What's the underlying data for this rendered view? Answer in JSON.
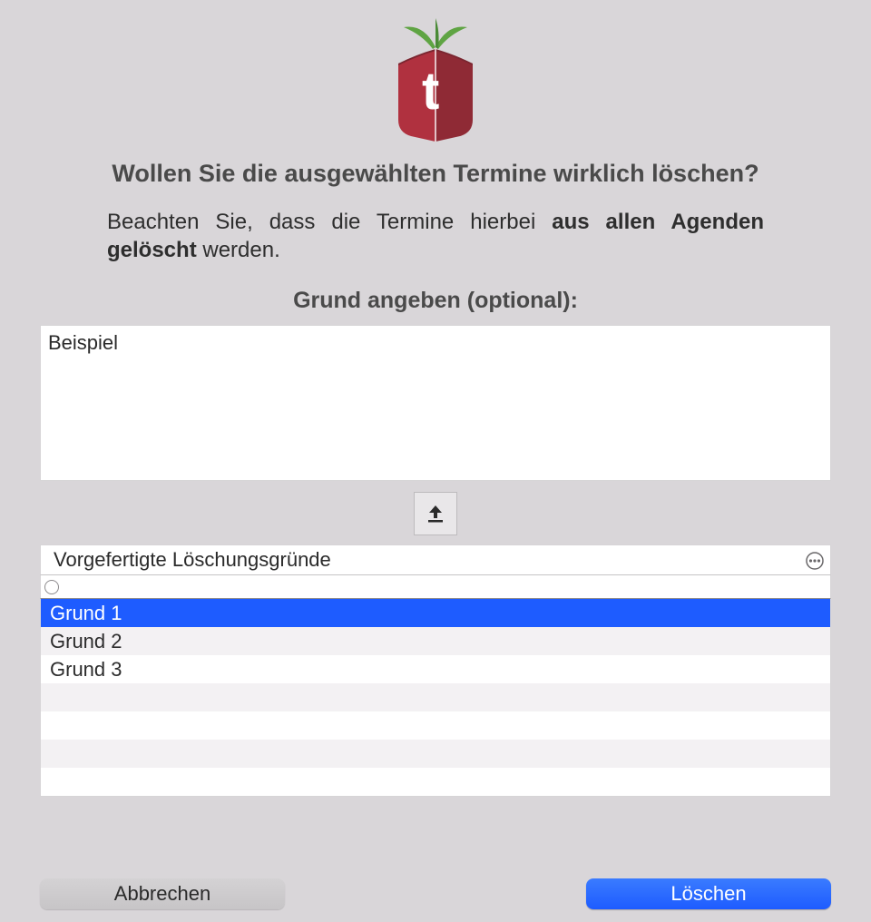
{
  "dialog": {
    "title": "Wollen Sie die ausgewählten Termine wirklich löschen?",
    "body_pre": "Beachten Sie, dass die Termine hierbei ",
    "body_bold": "aus allen Agenden gelöscht",
    "body_post": " werden.",
    "reason_label": "Grund angeben (optional):",
    "reason_value": "Beispiel",
    "preset_header": "Vorgefertigte Löschungsgründe",
    "preset_items": [
      "Grund 1",
      "Grund 2",
      "Grund 3",
      "",
      "",
      "",
      ""
    ],
    "preset_selected_index": 0,
    "buttons": {
      "cancel": "Abbrechen",
      "delete": "Löschen"
    },
    "icons": {
      "upload": "upload-icon",
      "more": "more-icon",
      "radio": "radio-empty-icon"
    }
  }
}
